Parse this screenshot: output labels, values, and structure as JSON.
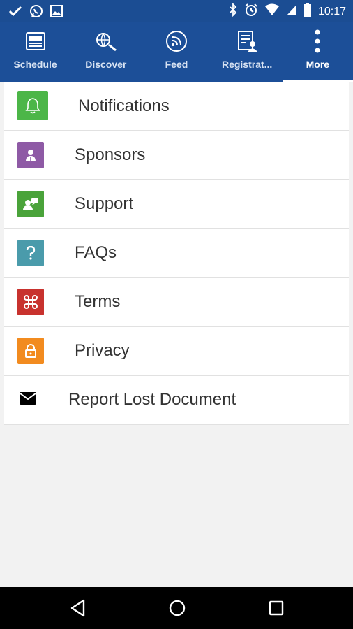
{
  "status_bar": {
    "time": "10:17",
    "left_icons": [
      "check-icon",
      "whatsapp-icon",
      "image-icon"
    ],
    "right_icons": [
      "bluetooth-icon",
      "alarm-icon",
      "wifi-icon",
      "signal-icon",
      "battery-icon"
    ]
  },
  "tabs": [
    {
      "label": "Schedule",
      "icon": "schedule-icon",
      "active": false
    },
    {
      "label": "Discover",
      "icon": "discover-icon",
      "active": false
    },
    {
      "label": "Feed",
      "icon": "feed-icon",
      "active": false
    },
    {
      "label": "Registrat...",
      "icon": "registration-icon",
      "active": false
    },
    {
      "label": "More",
      "icon": "more-icon",
      "active": true
    }
  ],
  "menu": [
    {
      "label": "Notifications",
      "icon": "bell-icon",
      "color": "#4cb648"
    },
    {
      "label": "Sponsors",
      "icon": "sponsor-icon",
      "color": "#8e5aa5"
    },
    {
      "label": "Support",
      "icon": "support-icon",
      "color": "#4aa33a"
    },
    {
      "label": "FAQs",
      "icon": "question-icon",
      "color": "#4a9bab"
    },
    {
      "label": "Terms",
      "icon": "command-icon",
      "color": "#c8322e"
    },
    {
      "label": "Privacy",
      "icon": "lock-icon",
      "color": "#f28b1f"
    },
    {
      "label": "Report Lost Document",
      "icon": "mail-icon",
      "color": "#000000"
    }
  ],
  "nav": [
    "back-icon",
    "home-icon",
    "recents-icon"
  ]
}
